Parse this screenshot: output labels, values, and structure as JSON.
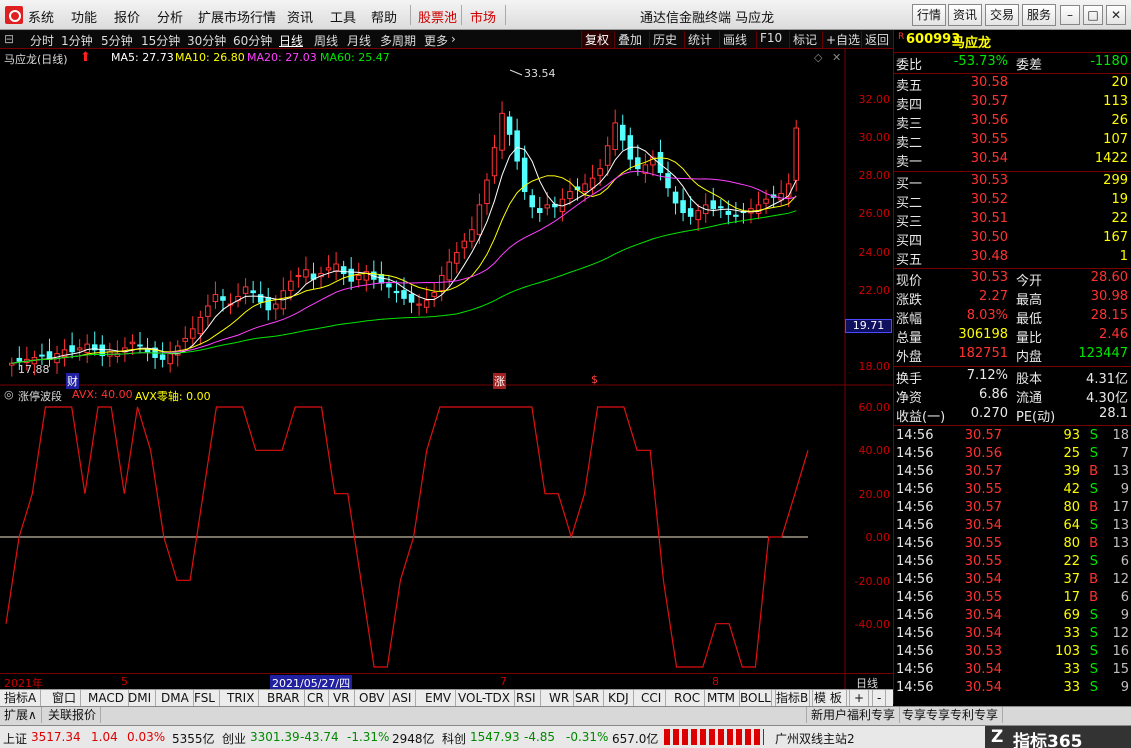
{
  "menu": {
    "items": [
      "系统",
      "功能",
      "报价",
      "分析",
      "扩展市场行情",
      "资讯",
      "工具",
      "帮助"
    ],
    "red_items": [
      "股票池",
      "市场"
    ],
    "window_title": "通达信金融终端 马应龙",
    "right_buttons": [
      "行情",
      "资讯",
      "交易",
      "服务"
    ]
  },
  "periods": {
    "items": [
      "分时",
      "1分钟",
      "5分钟",
      "15分钟",
      "30分钟",
      "60分钟",
      "日线",
      "周线",
      "月线",
      "多周期",
      "更多"
    ],
    "selected": "日线",
    "tools": [
      "复权",
      "叠加",
      "历史",
      "统计",
      "画线",
      "F10",
      "标记",
      "+自选",
      "返回"
    ]
  },
  "kchart": {
    "title": "马应龙(日线)",
    "ma5": "MA5: 27.73",
    "ma10": "MA10: 26.80",
    "ma20": "MA20: 27.03",
    "ma60": "MA60: 25.47",
    "high_label": "33.54",
    "low_label": "17.88",
    "current_price_tag": "19.71",
    "y_ticks": [
      "32.00",
      "30.00",
      "28.00",
      "26.00",
      "24.00",
      "22.00",
      "20.00",
      "18.00"
    ],
    "markers": [
      "财",
      "涨",
      "$"
    ]
  },
  "ind": {
    "title": "涨停波段",
    "avx": "AVX: 40.00",
    "avx_zero": "AVX零轴: 0.00",
    "y_ticks": [
      "60.00",
      "40.00",
      "20.00",
      "0.00",
      "-20.00",
      "-40.00"
    ],
    "period_label": "日线"
  },
  "timeline": {
    "year": "2021年",
    "m5": "5",
    "date": "2021/05/27/四",
    "m7": "7",
    "m8": "8"
  },
  "indicator_tabs": [
    "指标A",
    "窗口",
    "MACD",
    "DMI",
    "DMA",
    "FSL",
    "TRIX",
    "BRAR",
    "CR",
    "VR",
    "OBV",
    "ASI",
    "EMV",
    "VOL-TDX",
    "RSI",
    "WR",
    "SAR",
    "KDJ",
    "CCI",
    "ROC",
    "MTM",
    "BOLL"
  ],
  "indicator_tabs_right": [
    "指标B",
    "模 板",
    "+",
    "-"
  ],
  "ext_tabs": [
    "扩展∧",
    "关联报价"
  ],
  "ext_right": "新用户福利专享",
  "ext_right2": "专享专享专利专享",
  "quote": {
    "code_prefix": "R",
    "code": "600993",
    "name": "马应龙",
    "weibi_label": "委比",
    "weibi": "-53.73%",
    "weicha_label": "委差",
    "weicha": "-1180",
    "asks": [
      {
        "label": "卖五",
        "price": "30.58",
        "vol": "20"
      },
      {
        "label": "卖四",
        "price": "30.57",
        "vol": "113"
      },
      {
        "label": "卖三",
        "price": "30.56",
        "vol": "26"
      },
      {
        "label": "卖二",
        "price": "30.55",
        "vol": "107"
      },
      {
        "label": "卖一",
        "price": "30.54",
        "vol": "1422"
      }
    ],
    "bids": [
      {
        "label": "买一",
        "price": "30.53",
        "vol": "299"
      },
      {
        "label": "买二",
        "price": "30.52",
        "vol": "19"
      },
      {
        "label": "买三",
        "price": "30.51",
        "vol": "22"
      },
      {
        "label": "买四",
        "price": "30.50",
        "vol": "167"
      },
      {
        "label": "买五",
        "price": "30.48",
        "vol": "1"
      }
    ],
    "stats": [
      {
        "l1": "现价",
        "v1": "30.53",
        "c1": "red",
        "l2": "今开",
        "v2": "28.60",
        "c2": "red"
      },
      {
        "l1": "涨跌",
        "v1": "2.27",
        "c1": "red",
        "l2": "最高",
        "v2": "30.98",
        "c2": "red"
      },
      {
        "l1": "涨幅",
        "v1": "8.03%",
        "c1": "red",
        "l2": "最低",
        "v2": "28.15",
        "c2": "red"
      },
      {
        "l1": "总量",
        "v1": "306198",
        "c1": "yel",
        "l2": "量比",
        "v2": "2.46",
        "c2": "red"
      },
      {
        "l1": "外盘",
        "v1": "182751",
        "c1": "red",
        "l2": "内盘",
        "v2": "123447",
        "c2": "green"
      }
    ],
    "stats2": [
      {
        "l1": "换手",
        "v1": "7.12%",
        "l2": "股本",
        "v2": "4.31亿"
      },
      {
        "l1": "净资",
        "v1": "6.86",
        "l2": "流通",
        "v2": "4.30亿"
      },
      {
        "l1": "收益(一)",
        "v1": "0.270",
        "l2": "PE(动)",
        "v2": "28.1"
      }
    ],
    "ticks": [
      {
        "t": "14:56",
        "p": "30.57",
        "v": "93",
        "s": "S",
        "n": "18"
      },
      {
        "t": "14:56",
        "p": "30.56",
        "v": "25",
        "s": "S",
        "n": "7"
      },
      {
        "t": "14:56",
        "p": "30.57",
        "v": "39",
        "s": "B",
        "n": "13"
      },
      {
        "t": "14:56",
        "p": "30.55",
        "v": "42",
        "s": "S",
        "n": "9"
      },
      {
        "t": "14:56",
        "p": "30.57",
        "v": "80",
        "s": "B",
        "n": "17"
      },
      {
        "t": "14:56",
        "p": "30.54",
        "v": "64",
        "s": "S",
        "n": "13"
      },
      {
        "t": "14:56",
        "p": "30.55",
        "v": "80",
        "s": "B",
        "n": "13"
      },
      {
        "t": "14:56",
        "p": "30.55",
        "v": "22",
        "s": "S",
        "n": "6"
      },
      {
        "t": "14:56",
        "p": "30.54",
        "v": "37",
        "s": "B",
        "n": "12"
      },
      {
        "t": "14:56",
        "p": "30.55",
        "v": "17",
        "s": "B",
        "n": "6"
      },
      {
        "t": "14:56",
        "p": "30.54",
        "v": "69",
        "s": "S",
        "n": "9"
      },
      {
        "t": "14:56",
        "p": "30.54",
        "v": "33",
        "s": "S",
        "n": "12"
      },
      {
        "t": "14:56",
        "p": "30.53",
        "v": "103",
        "s": "S",
        "n": "16"
      },
      {
        "t": "14:56",
        "p": "30.54",
        "v": "33",
        "s": "S",
        "n": "15"
      },
      {
        "t": "14:56",
        "p": "30.54",
        "v": "33",
        "s": "S",
        "n": "9"
      }
    ]
  },
  "status": {
    "sh_label": "上证",
    "sh": "3517.34",
    "sh_chg": "1.04",
    "sh_pct": "0.03%",
    "sh_amt": "5355亿",
    "cy_label": "创业",
    "cy": "3301.39",
    "cy_chg": "-43.74",
    "cy_pct": "-1.31%",
    "cy_amt": "2948亿",
    "kc_label": "科创",
    "kc": "1547.93",
    "kc_chg": "-4.85",
    "kc_pct": "-0.31%",
    "kc_amt": "657.0亿",
    "server": "广州双线主站2",
    "brand": "指标365"
  },
  "colors": {
    "up": "#ff3232",
    "down": "#54ffff",
    "ma5": "#ffffff",
    "ma10": "#ffff00",
    "ma20": "#ff40ff",
    "ma60": "#00e600",
    "indicator": "#e01010"
  }
}
